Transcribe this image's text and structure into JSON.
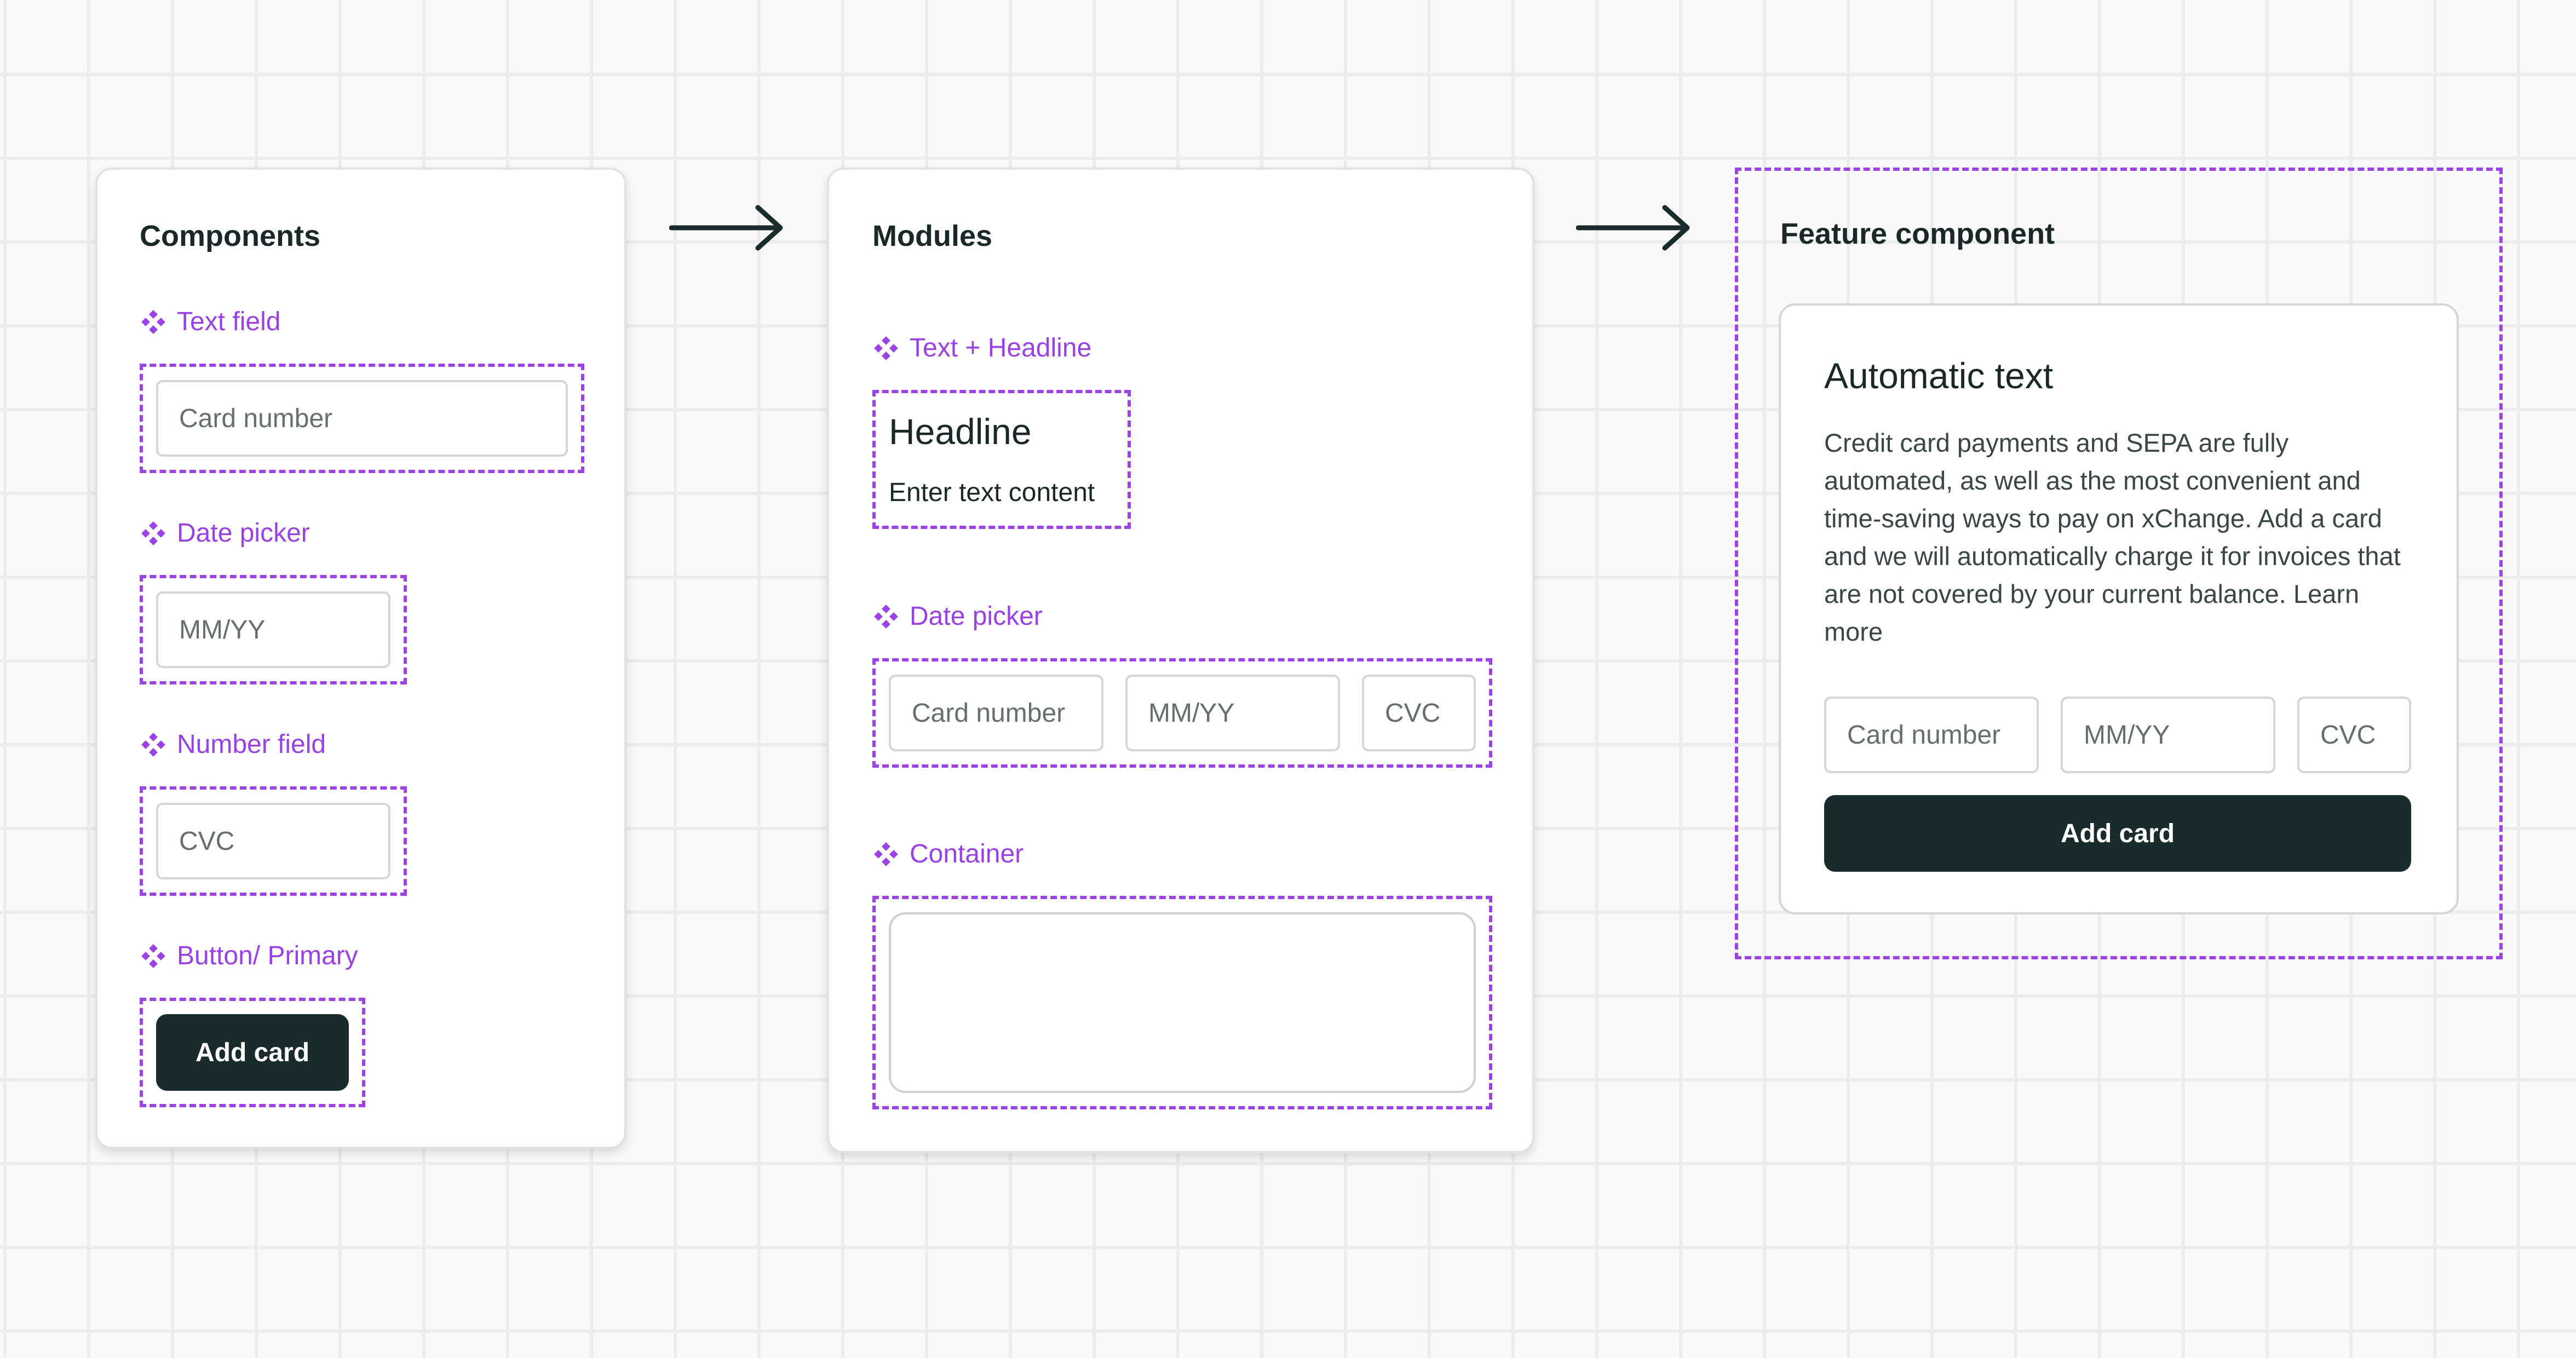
{
  "colors": {
    "accent": "#9b43e6",
    "dark": "#1a2b2b",
    "grid": "#ececec"
  },
  "components": {
    "title": "Components",
    "text_field": {
      "label": "Text field",
      "placeholder": "Card number"
    },
    "date_picker": {
      "label": "Date picker",
      "placeholder": "MM/YY"
    },
    "number_field": {
      "label": "Number field",
      "placeholder": "CVC"
    },
    "button": {
      "label": "Button/ Primary",
      "text": "Add card"
    }
  },
  "modules": {
    "title": "Modules",
    "text_headline": {
      "label": "Text + Headline",
      "headline": "Headline",
      "text": "Enter text content"
    },
    "date_picker": {
      "label": "Date picker",
      "card": "Card number",
      "date": "MM/YY",
      "cvc": "CVC"
    },
    "container": {
      "label": "Container"
    }
  },
  "feature": {
    "title": "Feature component",
    "heading": "Automatic text",
    "body": "Credit card payments and SEPA are fully automated, as well as the most convenient and time-saving ways to pay on xChange. Add a card and we will automatically charge it for invoices that are not covered by your current balance. Learn more",
    "card": "Card number",
    "date": "MM/YY",
    "cvc": "CVC",
    "button": "Add card"
  },
  "icons": {
    "component": "component-icon",
    "arrow": "arrow-right-icon"
  }
}
